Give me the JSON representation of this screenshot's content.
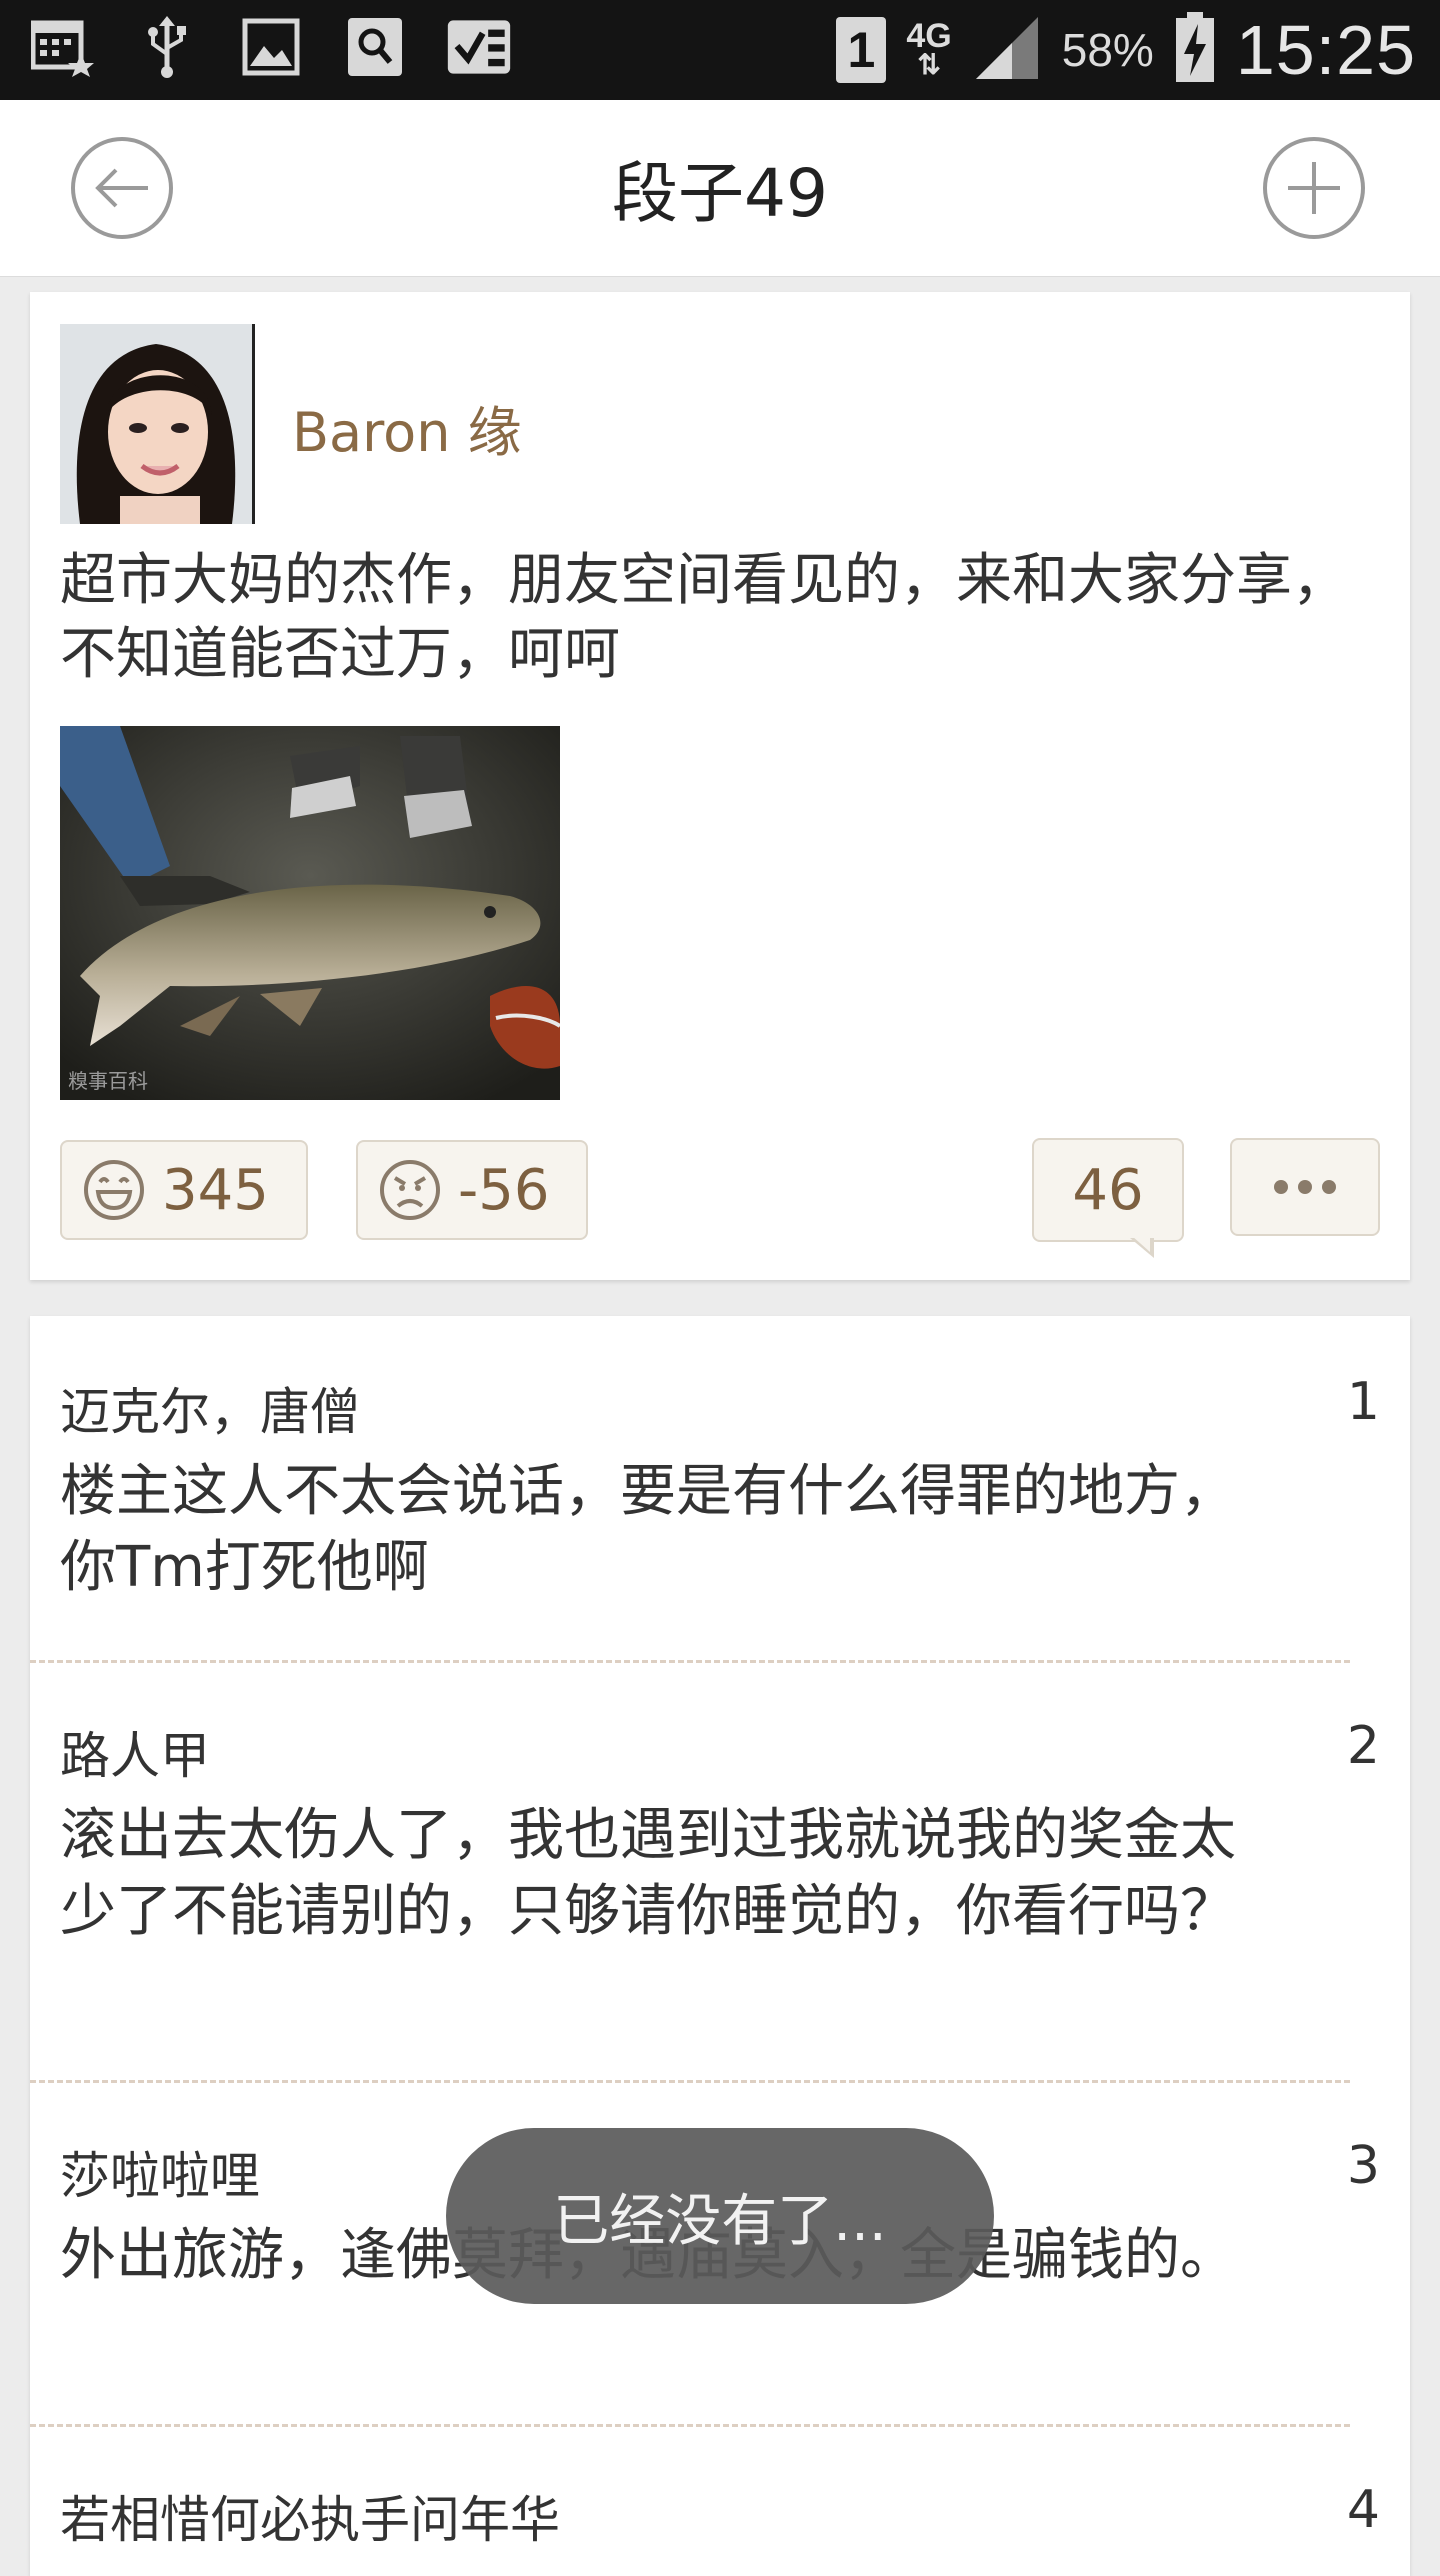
{
  "status_bar": {
    "battery": "58%",
    "time": "15:25",
    "network": "4G",
    "sim": "1",
    "icons": [
      "calendar-icon",
      "usb-icon",
      "image-icon",
      "search-icon",
      "check-icon"
    ]
  },
  "header": {
    "title": "段子49",
    "back_icon": "back-arrow-icon",
    "add_icon": "plus-icon"
  },
  "post": {
    "author": "Baron 缘",
    "text": "超市大妈的杰作，朋友空间看见的，来和大家分享，不知道能否过万，呵呵",
    "image_watermark": "糗事百科",
    "likes": "345",
    "dislikes": "-56",
    "comments": "46"
  },
  "comments": [
    {
      "author": "迈克尔，唐僧",
      "index": "1",
      "text": "楼主这人不太会说话，要是有什么得罪的地方，你Tm打死他啊"
    },
    {
      "author": "路人甲",
      "index": "2",
      "text": "滚出去太伤人了，我也遇到过我就说我的奖金太少了不能请别的，只够请你睡觉的，你看行吗？"
    },
    {
      "author": "莎啦啦哩",
      "index": "3",
      "text": "外出旅游，逢佛莫拜，遇庙莫入，全是骗钱的。"
    },
    {
      "author": "若相惜何必执手问年华",
      "index": "4",
      "text": ""
    }
  ],
  "toast": "已经没有了...",
  "colors": {
    "accent": "#8a6a45",
    "status_bar": "#141414",
    "button_bg": "#f7f4ee"
  }
}
